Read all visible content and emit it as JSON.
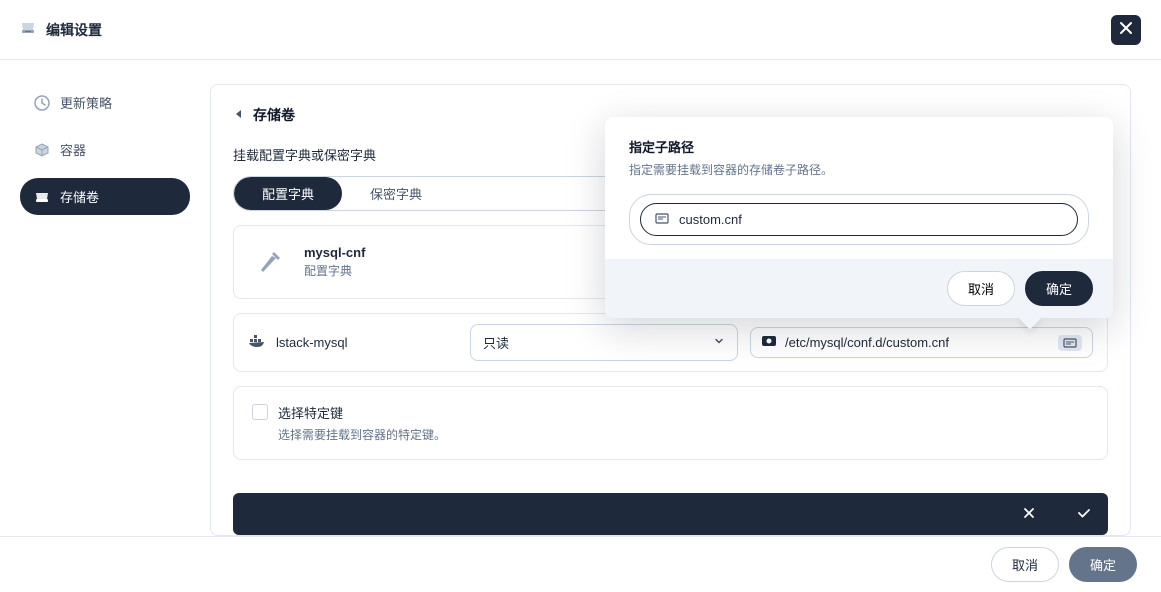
{
  "header": {
    "title": "编辑设置"
  },
  "sidebar": {
    "items": [
      {
        "label": "更新策略"
      },
      {
        "label": "容器"
      },
      {
        "label": "存储卷"
      }
    ]
  },
  "panel": {
    "title": "存储卷",
    "mount_label": "挂载配置字典或保密字典",
    "tabs": {
      "config": "配置字典",
      "secret": "保密字典"
    },
    "config_item": {
      "name": "mysql-cnf",
      "type": "配置字典"
    },
    "mount_row": {
      "container": "lstack-mysql",
      "mode": "只读",
      "path": "/etc/mysql/conf.d/custom.cnf"
    },
    "specific_keys": {
      "title": "选择特定键",
      "desc": "选择需要挂载到容器的特定键。"
    }
  },
  "popover": {
    "title": "指定子路径",
    "desc": "指定需要挂载到容器的存储卷子路径。",
    "value": "custom.cnf",
    "cancel": "取消",
    "confirm": "确定"
  },
  "footer": {
    "cancel": "取消",
    "confirm": "确定"
  }
}
